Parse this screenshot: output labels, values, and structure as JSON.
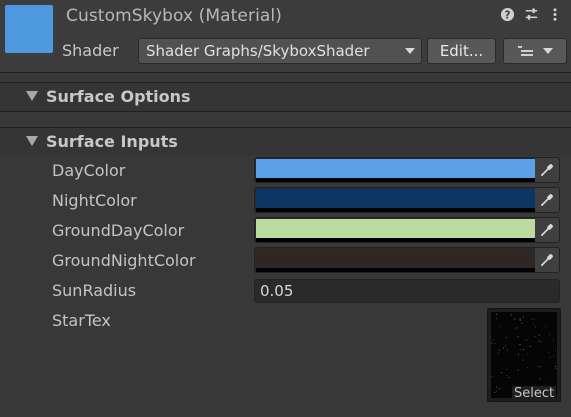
{
  "header": {
    "title": "CustomSkybox (Material)",
    "thumb_color": "#4f99e0",
    "icons": [
      "help-icon",
      "preset-sliders-icon",
      "kebab-menu-icon"
    ],
    "shader_label": "Shader",
    "shader_value": "Shader Graphs/SkyboxShader",
    "edit_label": "Edit...",
    "menu_icon": "list-menu-icon"
  },
  "sections": {
    "surface_options": {
      "label": "Surface Options"
    },
    "surface_inputs": {
      "label": "Surface Inputs"
    }
  },
  "properties": {
    "day_color": {
      "label": "DayColor",
      "color": "#5aa1ea"
    },
    "night_color": {
      "label": "NightColor",
      "color": "#0d3664"
    },
    "ground_day_color": {
      "label": "GroundDayColor",
      "color": "#bbdba3"
    },
    "ground_night_color": {
      "label": "GroundNightColor",
      "color": "#2f2724"
    },
    "sun_radius": {
      "label": "SunRadius",
      "value": "0.05"
    },
    "star_tex": {
      "label": "StarTex",
      "select_label": "Select"
    }
  }
}
